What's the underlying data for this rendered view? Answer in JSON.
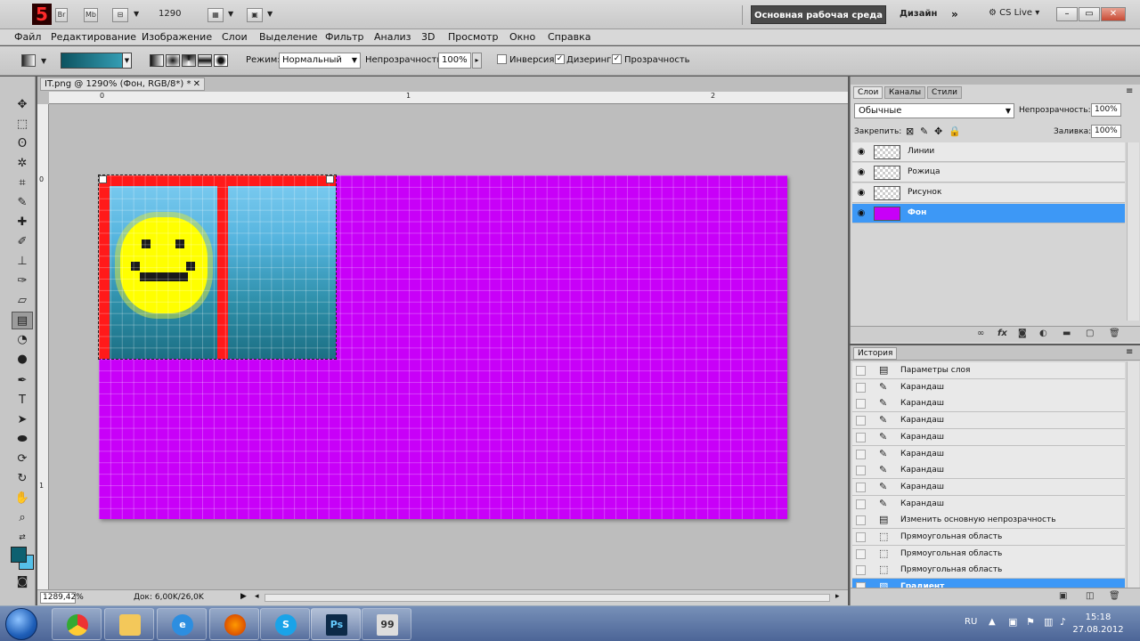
{
  "app": {
    "logo": "Ps",
    "br": "Br",
    "mb": "Mb",
    "zoom": "1290"
  },
  "workspace": {
    "active": "Основная рабочая среда",
    "design": "Дизайн",
    "cs_live": "CS Live"
  },
  "window_controls": {
    "minimize": "–",
    "restore": "▭",
    "close": "✕"
  },
  "menu": [
    "Файл",
    "Редактирование",
    "Изображение",
    "Слои",
    "Выделение",
    "Фильтр",
    "Анализ",
    "3D",
    "Просмотр",
    "Окно",
    "Справка"
  ],
  "options": {
    "mode_label": "Режим:",
    "mode_value": "Нормальный",
    "opacity_label": "Непрозрачность:",
    "opacity_value": "100%",
    "inversion": "Инверсия",
    "dither": "Дизеринг",
    "transparency": "Прозрачность",
    "inversion_checked": false,
    "dither_checked": true,
    "transparency_checked": true
  },
  "document": {
    "tab_title": "IT.png @ 1290% (Фон, RGB/8*) *",
    "ruler_top": [
      "0",
      "1",
      "2"
    ],
    "ruler_left": [
      "0",
      "1"
    ],
    "zoom_status": "1289,42%",
    "doc_info": "Док: 6,00K/26,0K"
  },
  "layers_panel": {
    "tabs": [
      "Слои",
      "Каналы",
      "Стили"
    ],
    "blend_mode": "Обычные",
    "opacity_label": "Непрозрачность:",
    "opacity_value": "100%",
    "lock_label": "Закрепить:",
    "fill_label": "Заливка:",
    "fill_value": "100%",
    "layers": [
      {
        "name": "Линии",
        "selected": false
      },
      {
        "name": "Рожица",
        "selected": false
      },
      {
        "name": "Рисунок",
        "selected": false
      },
      {
        "name": "Фон",
        "selected": true
      }
    ]
  },
  "history_panel": {
    "title": "История",
    "items": [
      {
        "name": "Параметры слоя",
        "icon": "layer-settings-icon"
      },
      {
        "name": "Карандаш",
        "icon": "pencil-icon"
      },
      {
        "name": "Карандаш",
        "icon": "pencil-icon"
      },
      {
        "name": "Карандаш",
        "icon": "pencil-icon"
      },
      {
        "name": "Карандаш",
        "icon": "pencil-icon"
      },
      {
        "name": "Карандаш",
        "icon": "pencil-icon"
      },
      {
        "name": "Карандаш",
        "icon": "pencil-icon"
      },
      {
        "name": "Карандаш",
        "icon": "pencil-icon"
      },
      {
        "name": "Карандаш",
        "icon": "pencil-icon"
      },
      {
        "name": "Изменить основную непрозрачность",
        "icon": "layer-settings-icon"
      },
      {
        "name": "Прямоугольная область",
        "icon": "marquee-icon"
      },
      {
        "name": "Прямоугольная область",
        "icon": "marquee-icon"
      },
      {
        "name": "Прямоугольная область",
        "icon": "marquee-icon"
      },
      {
        "name": "Градиент",
        "icon": "gradient-icon",
        "selected": true
      }
    ]
  },
  "taskbar": {
    "apps": [
      "Chrome",
      "Explorer",
      "Internet Explorer",
      "Firefox",
      "Skype",
      "Photoshop",
      "Total Commander"
    ],
    "photoshop_label": "Ps",
    "lang": "RU",
    "time": "15:18",
    "date": "27.08.2012"
  },
  "colors": {
    "canvas": "#c800f8",
    "selection_blue": "#3d98f6",
    "foreground": "#0d6070",
    "background": "#55c0e8"
  }
}
